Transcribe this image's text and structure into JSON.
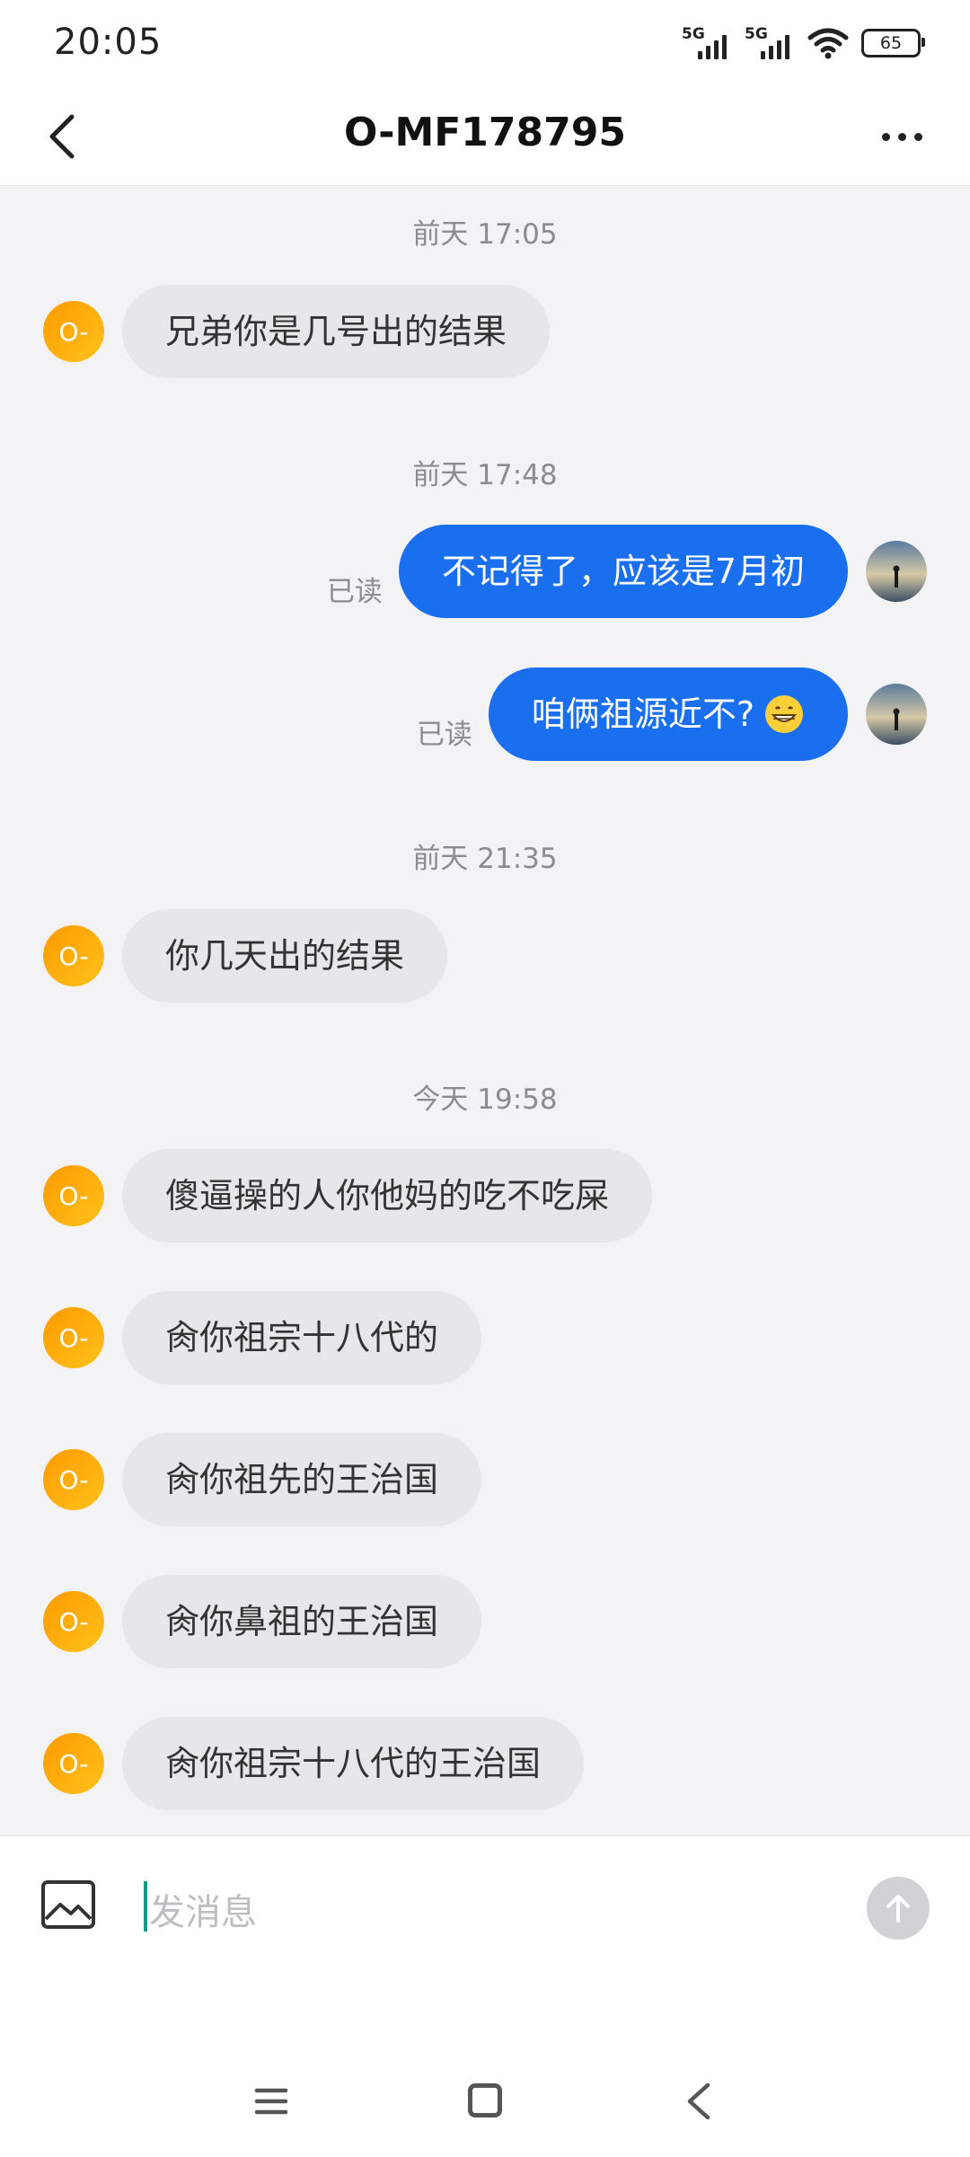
{
  "status_bar": {
    "time": "20:05",
    "network1": "5G",
    "network2": "5G",
    "battery": "65"
  },
  "header": {
    "title": "O-MF178795",
    "back_icon": "chevron-left-icon",
    "more_icon": "more-dots-icon"
  },
  "avatars": {
    "other_initials": "O-",
    "other_color": "#ff9f0a",
    "self_image": "person-at-sunset-avatar"
  },
  "colors": {
    "outgoing_bubble": "#1a6fef",
    "incoming_bubble": "#e7e7ea",
    "background": "#f3f3f6"
  },
  "messages": [
    {
      "type": "timestamp",
      "text": "前天 17:05"
    },
    {
      "type": "in",
      "text": "兄弟你是几号出的结果"
    },
    {
      "type": "timestamp",
      "text": "前天 17:48"
    },
    {
      "type": "out",
      "text": "不记得了，应该是7月初",
      "status": "已读"
    },
    {
      "type": "out",
      "text": "咱俩祖源近不?",
      "emoji": "grinning-face-emoji",
      "status": "已读"
    },
    {
      "type": "timestamp",
      "text": "前天 21:35"
    },
    {
      "type": "in",
      "text": "你几天出的结果"
    },
    {
      "type": "timestamp",
      "text": "今天 19:58"
    },
    {
      "type": "in",
      "text": "傻逼操的人你他妈的吃不吃屎"
    },
    {
      "type": "in",
      "text": "肏你祖宗十八代的"
    },
    {
      "type": "in",
      "text": "肏你祖先的王治国"
    },
    {
      "type": "in",
      "text": "肏你鼻祖的王治国"
    },
    {
      "type": "in",
      "text": "肏你祖宗十八代的王治国"
    }
  ],
  "composer": {
    "placeholder": "发消息",
    "image_icon": "image-icon",
    "send_icon": "arrow-up-icon"
  },
  "nav": {
    "menu_icon": "menu-icon",
    "home_icon": "home-square-icon",
    "back_icon": "back-triangle-icon"
  }
}
